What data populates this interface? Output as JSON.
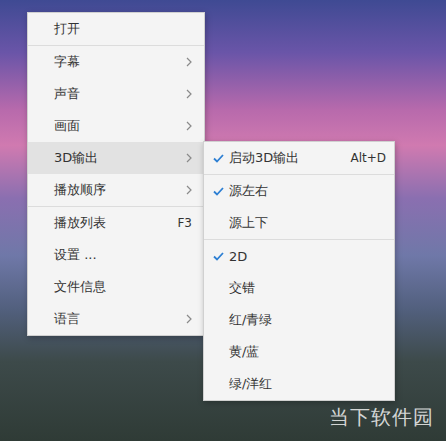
{
  "main_menu": {
    "groups": [
      [
        {
          "label": "打开",
          "shortcut": "",
          "submenu": false,
          "highlighted": false
        }
      ],
      [
        {
          "label": "字幕",
          "shortcut": "",
          "submenu": true,
          "highlighted": false
        },
        {
          "label": "声音",
          "shortcut": "",
          "submenu": true,
          "highlighted": false
        },
        {
          "label": "画面",
          "shortcut": "",
          "submenu": true,
          "highlighted": false
        },
        {
          "label": "3D输出",
          "shortcut": "",
          "submenu": true,
          "highlighted": true
        },
        {
          "label": "播放顺序",
          "shortcut": "",
          "submenu": true,
          "highlighted": false
        }
      ],
      [
        {
          "label": "播放列表",
          "shortcut": "F3",
          "submenu": false,
          "highlighted": false
        },
        {
          "label": "设置 ...",
          "shortcut": "",
          "submenu": false,
          "highlighted": false
        },
        {
          "label": "文件信息",
          "shortcut": "",
          "submenu": false,
          "highlighted": false
        },
        {
          "label": "语言",
          "shortcut": "",
          "submenu": true,
          "highlighted": false
        }
      ]
    ]
  },
  "submenu_3d": {
    "groups": [
      [
        {
          "label": "启动3D输出",
          "shortcut": "Alt+D",
          "checked": true
        }
      ],
      [
        {
          "label": "源左右",
          "shortcut": "",
          "checked": true
        },
        {
          "label": "源上下",
          "shortcut": "",
          "checked": false
        }
      ],
      [
        {
          "label": "2D",
          "shortcut": "",
          "checked": true
        },
        {
          "label": "交错",
          "shortcut": "",
          "checked": false
        },
        {
          "label": "红/青绿",
          "shortcut": "",
          "checked": false
        },
        {
          "label": "黄/蓝",
          "shortcut": "",
          "checked": false
        },
        {
          "label": "绿/洋红",
          "shortcut": "",
          "checked": false
        }
      ]
    ]
  },
  "watermark": {
    "text": "当下软件园"
  }
}
